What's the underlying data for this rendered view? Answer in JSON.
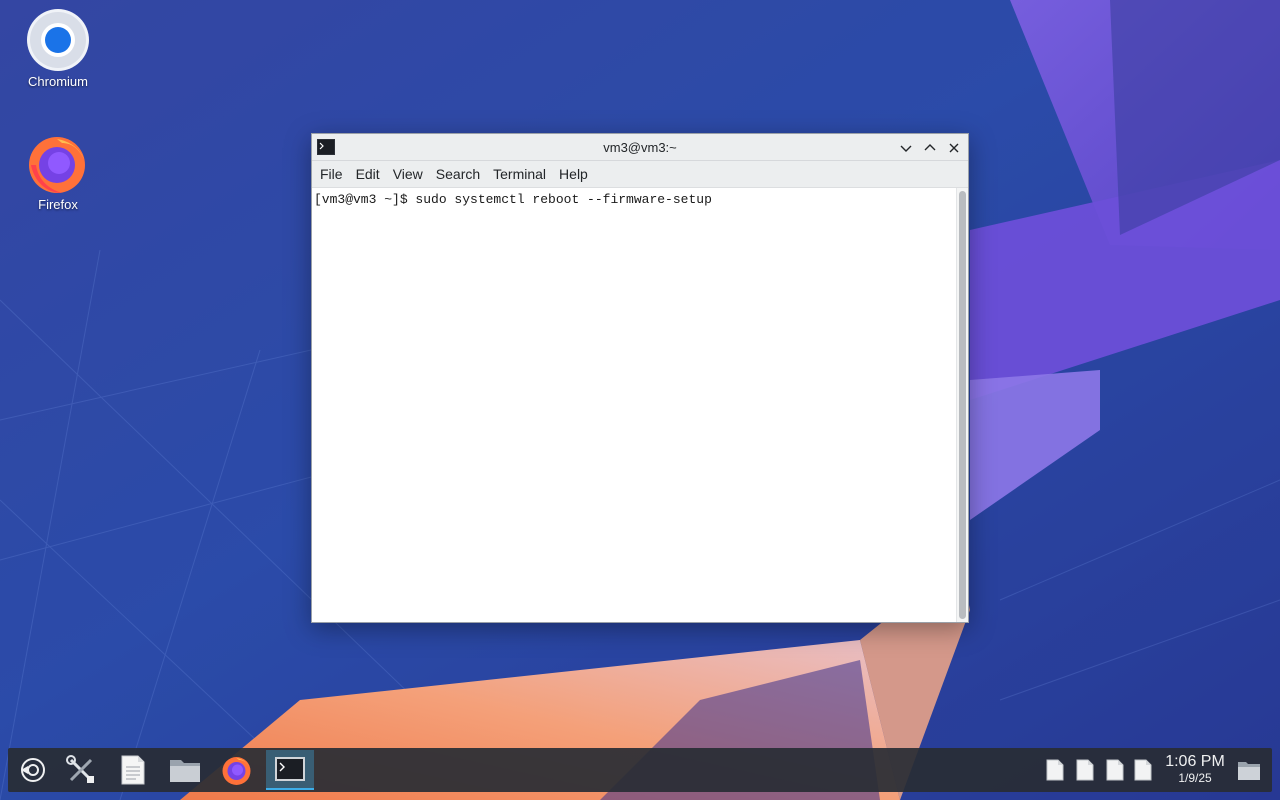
{
  "desktop": {
    "icons": [
      {
        "label": "Chromium",
        "icon": "chromium-icon"
      },
      {
        "label": "Firefox",
        "icon": "firefox-icon"
      }
    ]
  },
  "window": {
    "title": "vm3@vm3:~",
    "menu": [
      "File",
      "Edit",
      "View",
      "Search",
      "Terminal",
      "Help"
    ],
    "terminal_lines": [
      "[vm3@vm3 ~]$ sudo systemctl reboot --firmware-setup"
    ]
  },
  "taskbar": {
    "launchers": [
      "application-menu-icon",
      "settings-tools-icon",
      "text-editor-icon",
      "file-manager-icon",
      "firefox-icon",
      "terminal-icon"
    ],
    "active": "terminal-icon",
    "clock": {
      "time": "1:06 PM",
      "date": "1/9/25"
    }
  },
  "colors": {
    "accent": "#3daee9",
    "taskbar_bg": "#282c34",
    "window_chrome": "#eceeef"
  }
}
